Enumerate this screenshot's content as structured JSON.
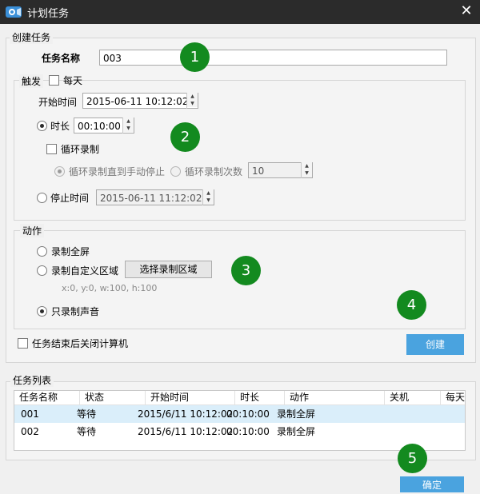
{
  "window": {
    "title": "计划任务",
    "icon": "app-camera-icon",
    "close_icon": "close-icon"
  },
  "create_task": {
    "group_label": "创建任务",
    "name_label": "任务名称",
    "name_value": "003"
  },
  "trigger": {
    "group_label": "触发",
    "daily_label": "每天",
    "daily_checked": false,
    "start_label": "开始时间",
    "start_value": "2015-06-11 10:12:02",
    "duration_label": "时长",
    "duration_selected": true,
    "duration_value": "00:10:00",
    "loop_label": "循环录制",
    "loop_checked": false,
    "loop_until_stop_label": "循环录制直到手动停止",
    "loop_count_label": "循环录制次数",
    "loop_count_value": "10",
    "stop_label": "停止时间",
    "stop_value": "2015-06-11 11:12:02"
  },
  "action": {
    "group_label": "动作",
    "full_screen_label": "录制全屏",
    "custom_region_label": "录制自定义区域",
    "select_region_button": "选择录制区域",
    "region_text": "x:0, y:0, w:100, h:100",
    "audio_only_label": "只录制声音",
    "selected": "audio_only"
  },
  "shutdown_label": "任务结束后关闭计算机",
  "create_button": "创建",
  "task_list": {
    "group_label": "任务列表",
    "columns": [
      "任务名称",
      "状态",
      "开始时间",
      "时长",
      "动作",
      "关机",
      "每天"
    ],
    "rows": [
      {
        "name": "001",
        "status": "等待",
        "start": "2015/6/11 10:12:02",
        "duration": "00:10:00",
        "action": "录制全屏",
        "shutdown": "",
        "daily": ""
      },
      {
        "name": "002",
        "status": "等待",
        "start": "2015/6/11 10:12:02",
        "duration": "00:10:00",
        "action": "录制全屏",
        "shutdown": "",
        "daily": ""
      }
    ]
  },
  "ok_button": "确定",
  "badges": [
    "1",
    "2",
    "3",
    "4",
    "5"
  ],
  "colors": {
    "titlebar": "#2b2b2b",
    "accent_button": "#4aa3df",
    "badge": "#138a1f",
    "selected_row": "#daeefa"
  }
}
